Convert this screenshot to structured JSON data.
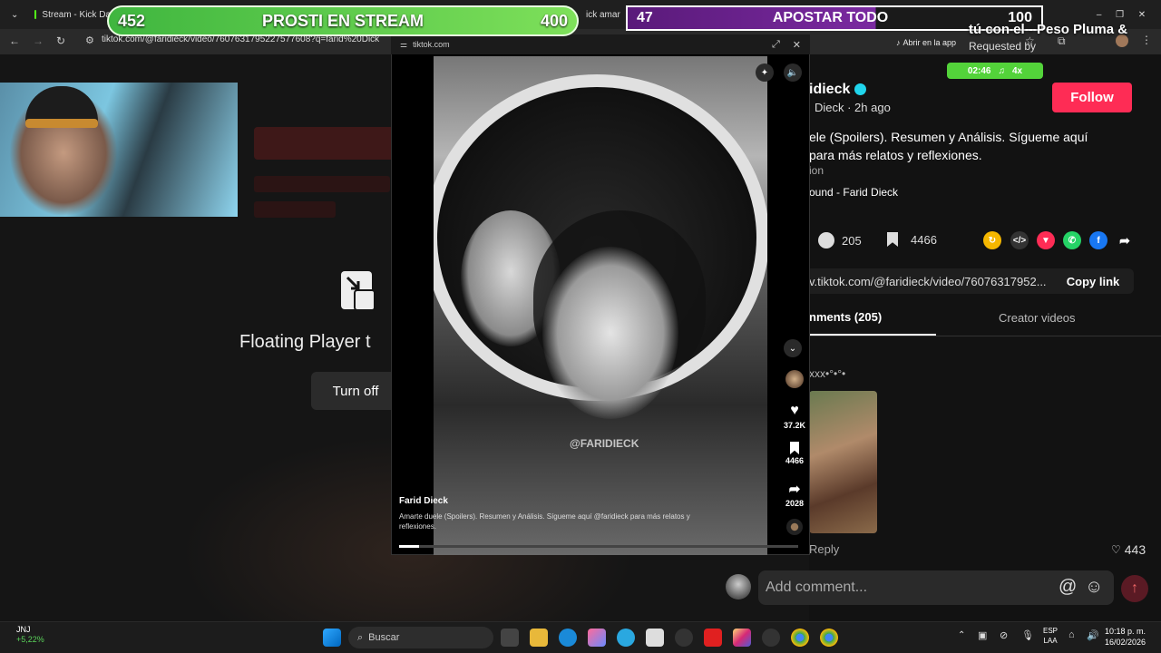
{
  "browser": {
    "tabs": [
      {
        "label": "Stream - Kick Da"
      },
      {
        "label": "ick amar"
      }
    ],
    "url": "tiktok.com/@faridieck/video/7607631795227577608?q=farid%20Dick"
  },
  "stream_overlay": {
    "bar_green": {
      "left": "452",
      "title": "PROSTI EN STREAM",
      "right": "400"
    },
    "bar_purple": {
      "left": "47",
      "title": "APOSTAR TODO",
      "right": "100"
    },
    "song": "tú con el - Peso Pluma &",
    "requested": "Requested by",
    "open_app": "Abrir en la app",
    "song_time": "02:46",
    "song_count": "4x"
  },
  "floating_player": {
    "text": "Floating Player t",
    "turn_off": "Turn off",
    "window_host": "tiktok.com",
    "video_author": "Farid Dieck",
    "video_desc": "Amarte duele (Spoilers). Resumen y Análisis. Sígueme aquí @faridieck para más relatos y reflexiones.",
    "watermark": "@FARIDIECK",
    "progress_fraction": 0.05,
    "likes": "37.2K",
    "saves": "4466",
    "shares": "2028"
  },
  "right_panel": {
    "author_name": "idieck",
    "author_meta": "Dieck · 2h ago",
    "follow": "Follow",
    "desc_line1": "ele (Spoilers). Resumen y Análisis. Sígueme aquí",
    "desc_line2": "para más relatos y reflexiones.",
    "desc_line3": "ion",
    "sound": "ound - Farid Dieck",
    "comments_count": "205",
    "saves_count": "4466",
    "link": "v.tiktok.com/@faridieck/video/76076317952...",
    "copy_link": "Copy link",
    "tab_comments": "nments (205)",
    "tab_creator": "Creator videos",
    "commenter": "xxx•°•°•",
    "reply": "Reply",
    "comment_likes": "443",
    "add_comment": "Add comment..."
  },
  "taskbar": {
    "stock_name": "JNJ",
    "stock_change": "+5,22%",
    "search": "Buscar",
    "lang_1": "ESP",
    "lang_2": "LAA",
    "time": "10:18 p. m.",
    "date": "16/02/2026"
  }
}
